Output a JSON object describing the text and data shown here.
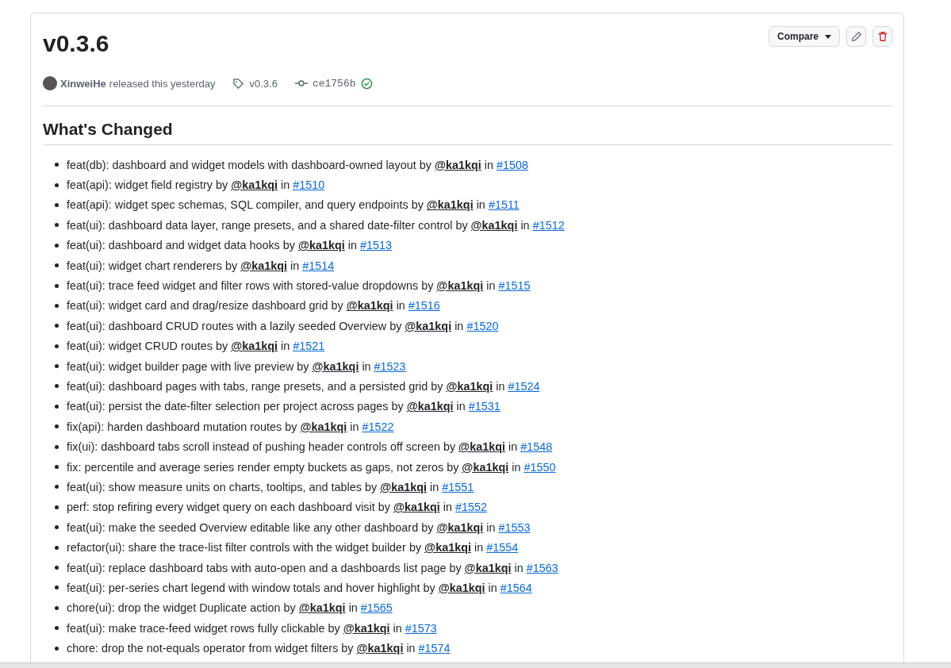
{
  "release": {
    "title": "v0.3.6",
    "author": "XinweiHe",
    "released": "released this yesterday",
    "tag": "v0.3.6",
    "commit": "ce1756b",
    "verified": true,
    "compare_button": "Compare"
  },
  "section": {
    "heading": "What's Changed",
    "items": [
      {
        "text": "feat(db): dashboard and widget models with dashboard-owned layout",
        "by": "by",
        "author": "@ka1kqi",
        "in": "in",
        "pr": "#1508"
      },
      {
        "text": "feat(api): widget field registry",
        "by": "by",
        "author": "@ka1kqi",
        "in": "in",
        "pr": "#1510"
      },
      {
        "text": "feat(api): widget spec schemas, SQL compiler, and query endpoints",
        "by": "by",
        "author": "@ka1kqi",
        "in": "in",
        "pr": "#1511"
      },
      {
        "text": "feat(ui): dashboard data layer, range presets, and a shared date-filter control",
        "by": "by",
        "author": "@ka1kqi",
        "in": "in",
        "pr": "#1512"
      },
      {
        "text": "feat(ui): dashboard and widget data hooks",
        "by": "by",
        "author": "@ka1kqi",
        "in": "in",
        "pr": "#1513"
      },
      {
        "text": "feat(ui): widget chart renderers",
        "by": "by",
        "author": "@ka1kqi",
        "in": "in",
        "pr": "#1514"
      },
      {
        "text": "feat(ui): trace feed widget and filter rows with stored-value dropdowns",
        "by": "by",
        "author": "@ka1kqi",
        "in": "in",
        "pr": "#1515"
      },
      {
        "text": "feat(ui): widget card and drag/resize dashboard grid",
        "by": "by",
        "author": "@ka1kqi",
        "in": "in",
        "pr": "#1516"
      },
      {
        "text": "feat(ui): dashboard CRUD routes with a lazily seeded Overview",
        "by": "by",
        "author": "@ka1kqi",
        "in": "in",
        "pr": "#1520"
      },
      {
        "text": "feat(ui): widget CRUD routes",
        "by": "by",
        "author": "@ka1kqi",
        "in": "in",
        "pr": "#1521"
      },
      {
        "text": "feat(ui): widget builder page with live preview",
        "by": "by",
        "author": "@ka1kqi",
        "in": "in",
        "pr": "#1523"
      },
      {
        "text": "feat(ui): dashboard pages with tabs, range presets, and a persisted grid",
        "by": "by",
        "author": "@ka1kqi",
        "in": "in",
        "pr": "#1524"
      },
      {
        "text": "feat(ui): persist the date-filter selection per project across pages",
        "by": "by",
        "author": "@ka1kqi",
        "in": "in",
        "pr": "#1531"
      },
      {
        "text": "fix(api): harden dashboard mutation routes",
        "by": "by",
        "author": "@ka1kqi",
        "in": "in",
        "pr": "#1522"
      },
      {
        "text": "fix(ui): dashboard tabs scroll instead of pushing header controls off screen",
        "by": "by",
        "author": "@ka1kqi",
        "in": "in",
        "pr": "#1548"
      },
      {
        "text": "fix: percentile and average series render empty buckets as gaps, not zeros",
        "by": "by",
        "author": "@ka1kqi",
        "in": "in",
        "pr": "#1550"
      },
      {
        "text": "feat(ui): show measure units on charts, tooltips, and tables",
        "by": "by",
        "author": "@ka1kqi",
        "in": "in",
        "pr": "#1551"
      },
      {
        "text": "perf: stop refiring every widget query on each dashboard visit",
        "by": "by",
        "author": "@ka1kqi",
        "in": "in",
        "pr": "#1552"
      },
      {
        "text": "feat(ui): make the seeded Overview editable like any other dashboard",
        "by": "by",
        "author": "@ka1kqi",
        "in": "in",
        "pr": "#1553"
      },
      {
        "text": "refactor(ui): share the trace-list filter controls with the widget builder",
        "by": "by",
        "author": "@ka1kqi",
        "in": "in",
        "pr": "#1554"
      },
      {
        "text": "feat(ui): replace dashboard tabs with auto-open and a dashboards list page",
        "by": "by",
        "author": "@ka1kqi",
        "in": "in",
        "pr": "#1563"
      },
      {
        "text": "feat(ui): per-series chart legend with window totals and hover highlight",
        "by": "by",
        "author": "@ka1kqi",
        "in": "in",
        "pr": "#1564"
      },
      {
        "text": "chore(ui): drop the widget Duplicate action",
        "by": "by",
        "author": "@ka1kqi",
        "in": "in",
        "pr": "#1565"
      },
      {
        "text": "feat(ui): make trace-feed widget rows fully clickable",
        "by": "by",
        "author": "@ka1kqi",
        "in": "in",
        "pr": "#1573"
      },
      {
        "text": "chore: drop the not-equals operator from widget filters",
        "by": "by",
        "author": "@ka1kqi",
        "in": "in",
        "pr": "#1574"
      }
    ]
  }
}
